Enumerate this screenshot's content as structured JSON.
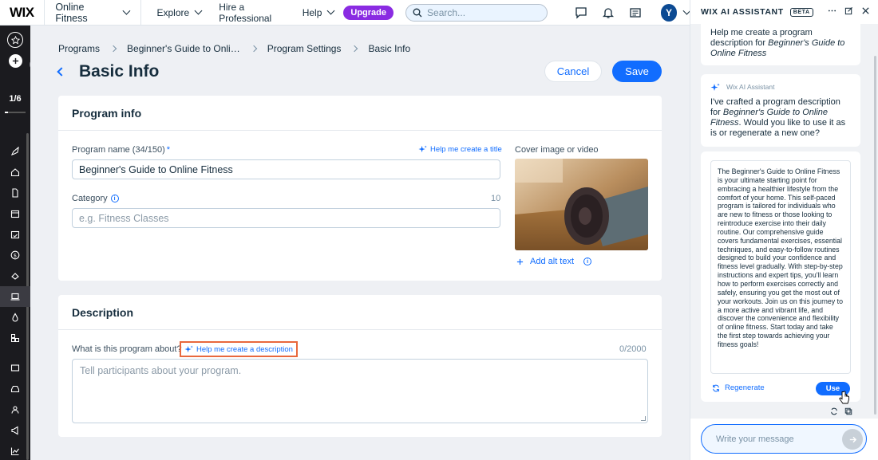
{
  "topbar": {
    "logo": "WIX",
    "site_name": "Online Fitness",
    "nav": [
      {
        "label": "Explore"
      },
      {
        "label": "Hire a Professional"
      },
      {
        "label": "Help"
      }
    ],
    "upgrade_label": "Upgrade",
    "search_placeholder": "Search...",
    "avatar_initial": "Y"
  },
  "leftbar": {
    "progress_text": "1/6",
    "progress_fraction": 0.1667
  },
  "breadcrumb": [
    "Programs",
    "Beginner's Guide to Onli…",
    "Program Settings",
    "Basic Info"
  ],
  "page": {
    "title": "Basic Info",
    "cancel_label": "Cancel",
    "save_label": "Save"
  },
  "program_info": {
    "header": "Program info",
    "name_label": "Program name (34/150)",
    "required_mark": "*",
    "ai_title_link": "Help me create a title",
    "name_value": "Beginner's Guide to Online Fitness",
    "category_label": "Category",
    "category_count": "10",
    "category_placeholder": "e.g. Fitness Classes",
    "cover_label": "Cover image or video",
    "alt_text_link": "Add alt text"
  },
  "description": {
    "header": "Description",
    "question_label": "What is this program about?",
    "ai_desc_link": "Help me create a description",
    "counter": "0/2000",
    "placeholder": "Tell participants about your program."
  },
  "assistant": {
    "title": "WIX AI ASSISTANT",
    "beta": "BETA",
    "user_msg_1": "Help me create a program description for ",
    "user_msg_em": "Beginner's Guide to Online Fitness",
    "ai_name": "Wix AI Assistant",
    "ai_msg_1": "I've crafted a program description for ",
    "ai_msg_em": "Beginner's Guide to Online Fitness",
    "ai_msg_2": ". Would you like to use it as is or regenerate a new one?",
    "generated_description": "The Beginner's Guide to Online Fitness is your ultimate starting point for embracing a healthier lifestyle from the comfort of your home. This self-paced program is tailored for individuals who are new to fitness or those looking to reintroduce exercise into their daily routine. Our comprehensive guide covers fundamental exercises, essential techniques, and easy-to-follow routines designed to build your confidence and fitness level gradually. With step-by-step instructions and expert tips, you'll learn how to perform exercises correctly and safely, ensuring you get the most out of your workouts. Join us on this journey to a more active and vibrant life, and discover the convenience and flexibility of online fitness. Start today and take the first step towards achieving your fitness goals!",
    "regenerate_label": "Regenerate",
    "use_label": "Use",
    "message_placeholder": "Write your message"
  }
}
